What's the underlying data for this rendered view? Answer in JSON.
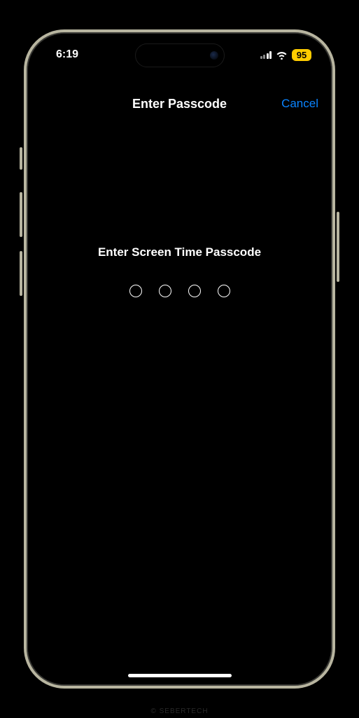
{
  "status_bar": {
    "time": "6:19",
    "battery_level": "95",
    "cellular_bars_active": 2,
    "cellular_bars_total": 4
  },
  "nav": {
    "title": "Enter Passcode",
    "cancel_label": "Cancel"
  },
  "content": {
    "prompt": "Enter Screen Time Passcode",
    "digits_total": 4,
    "digits_entered": 0
  },
  "watermark": "© SEBERTECH"
}
